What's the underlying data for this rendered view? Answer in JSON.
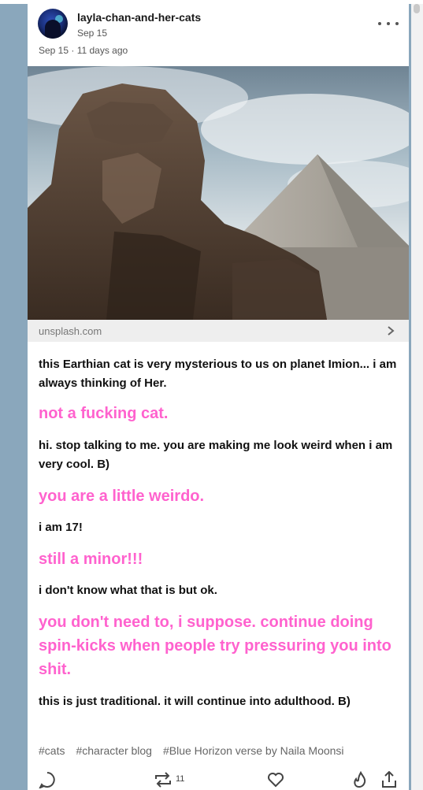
{
  "post": {
    "blog_name": "layla-chan-and-her-cats",
    "follow_date": "Sep 15",
    "post_date": "Sep 15 · 11 days ago",
    "more_menu_icon": "ellipsis-icon"
  },
  "image": {
    "subject": "sphinx-and-pyramid-photo"
  },
  "link": {
    "domain": "unsplash.com",
    "icon": "chevron-right-icon"
  },
  "conversation": [
    {
      "speaker": "black",
      "text": "this Earthian cat is very mysterious to us on planet Imion... i am always thinking of Her."
    },
    {
      "speaker": "pink",
      "text": "not a fucking cat."
    },
    {
      "speaker": "black",
      "text": "hi. stop talking to me. you are making me look weird when i am very cool. B)"
    },
    {
      "speaker": "pink",
      "text": "you are a little weirdo."
    },
    {
      "speaker": "black",
      "text": "i am 17!"
    },
    {
      "speaker": "pink",
      "text": "still a minor!!!"
    },
    {
      "speaker": "black",
      "text": "i don't know what that is but ok."
    },
    {
      "speaker": "pink",
      "text": "you don't need to, i suppose. continue doing spin-kicks when people try pressuring you into shit."
    },
    {
      "speaker": "black",
      "text": "this is just traditional. it will continue into adulthood. B)"
    }
  ],
  "tags": [
    "#cats",
    "#character blog",
    "#Blue Horizon verse by Naila Moonsi"
  ],
  "actions": {
    "reblog_count": "11",
    "icons": [
      "reply-icon",
      "reblog-icon",
      "like-icon",
      "notes-flame-icon",
      "share-icon"
    ]
  },
  "colors": {
    "background": "#8aa7bc",
    "pink_text": "#ff62ce",
    "black_text": "#111111"
  }
}
